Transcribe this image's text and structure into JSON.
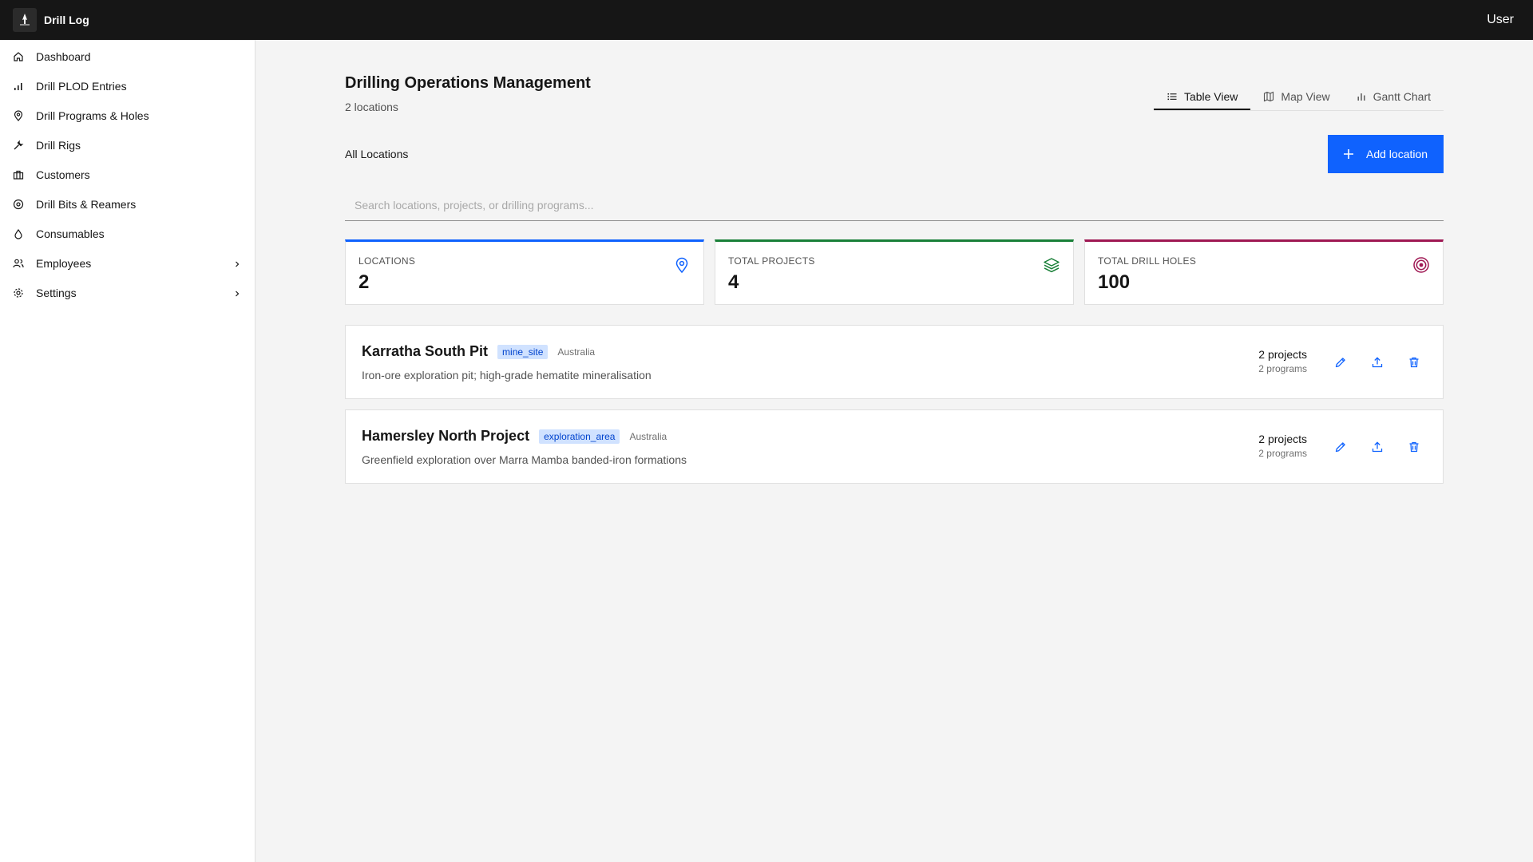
{
  "app": {
    "title": "Drill Log",
    "user": "User"
  },
  "sidebar": {
    "items": [
      {
        "label": "Dashboard"
      },
      {
        "label": "Drill PLOD Entries"
      },
      {
        "label": "Drill Programs & Holes"
      },
      {
        "label": "Drill Rigs"
      },
      {
        "label": "Customers"
      },
      {
        "label": "Drill Bits & Reamers"
      },
      {
        "label": "Consumables"
      },
      {
        "label": "Employees"
      },
      {
        "label": "Settings"
      }
    ]
  },
  "page": {
    "title": "Drilling Operations Management",
    "subtitle": "2 locations",
    "section_label": "All Locations",
    "add_button": "Add location",
    "search_placeholder": "Search locations, projects, or drilling programs..."
  },
  "tabs": [
    {
      "label": "Table View",
      "active": true
    },
    {
      "label": "Map View",
      "active": false
    },
    {
      "label": "Gantt Chart",
      "active": false
    }
  ],
  "stats": [
    {
      "label": "LOCATIONS",
      "value": "2",
      "color": "#0f62fe",
      "icon": "map-pin-icon"
    },
    {
      "label": "TOTAL PROJECTS",
      "value": "4",
      "color": "#198038",
      "icon": "layers-icon"
    },
    {
      "label": "TOTAL DRILL HOLES",
      "value": "100",
      "color": "#9f1853",
      "icon": "target-icon"
    }
  ],
  "locations": [
    {
      "name": "Karratha South Pit",
      "type": "mine_site",
      "country": "Australia",
      "description": "Iron-ore exploration pit; high-grade hematite mineralisation",
      "projects": "2 projects",
      "programs": "2 programs"
    },
    {
      "name": "Hamersley North Project",
      "type": "exploration_area",
      "country": "Australia",
      "description": "Greenfield exploration over Marra Mamba banded-iron formations",
      "projects": "2 projects",
      "programs": "2 programs"
    }
  ],
  "colors": {
    "accent": "#0f62fe",
    "header": "#161616"
  }
}
